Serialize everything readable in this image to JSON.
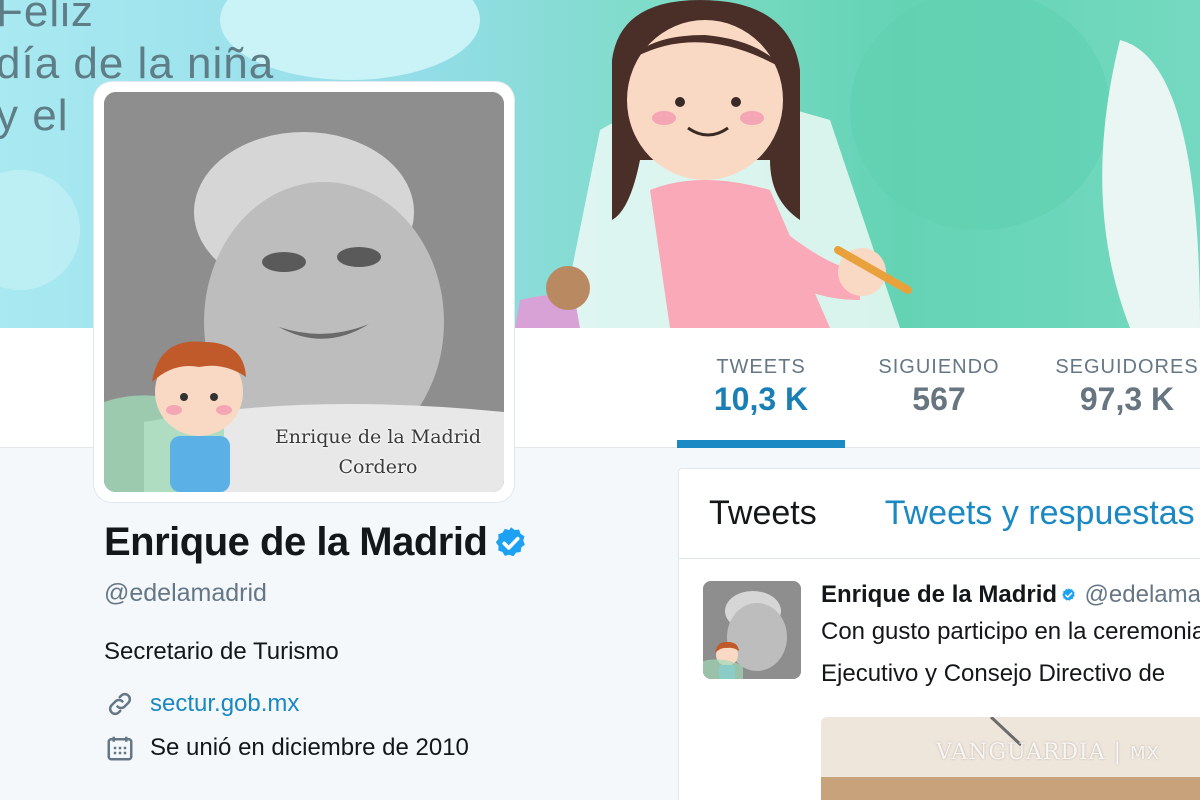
{
  "banner": {
    "lines": [
      "Feliz",
      "día de la niña",
      "y el"
    ]
  },
  "avatar": {
    "caption_line1": "Enrique de la Madrid",
    "caption_line2": "Cordero"
  },
  "stats": [
    {
      "label": "TWEETS",
      "value": "10,3 K",
      "active": true
    },
    {
      "label": "SIGUIENDO",
      "value": "567",
      "active": false
    },
    {
      "label": "SEGUIDORES",
      "value": "97,3 K",
      "active": false
    }
  ],
  "profile": {
    "name": "Enrique de la Madrid",
    "handle": "@edelamadrid",
    "bio": "Secretario de Turismo",
    "website": "sectur.gob.mx",
    "joined": "Se unió en diciembre de 2010"
  },
  "timeline": {
    "tabs": [
      "Tweets",
      "Tweets y respuestas"
    ],
    "tweet": {
      "name": "Enrique de la Madrid",
      "handle": "@edelamadrid",
      "line1": "Con gusto participo en la ceremonia",
      "line2": "Ejecutivo y Consejo Directivo de"
    }
  },
  "watermark": {
    "brand": "VANGUARDIA",
    "suffix": "MX"
  },
  "icons": {
    "verified": "verified-badge-icon",
    "link": "link-icon",
    "calendar": "calendar-icon"
  },
  "colors": {
    "accent": "#1b95e0",
    "verified": "#1da1f2"
  }
}
